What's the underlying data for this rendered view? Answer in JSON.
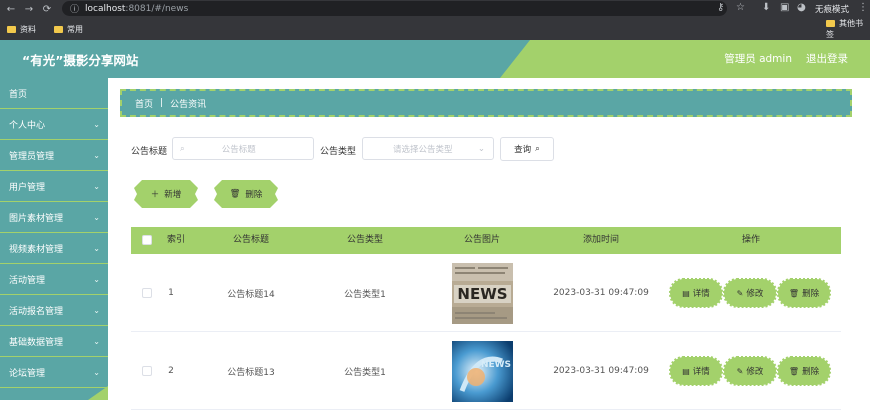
{
  "browser": {
    "url_host": "localhost",
    "url_rest": ":8081/#/news",
    "incognito_label": "无痕模式",
    "bookmarks": [
      {
        "label": "资料"
      },
      {
        "label": "常用"
      }
    ],
    "other_bookmarks": "其他书签"
  },
  "header": {
    "site_title": "“有光”摄影分享网站",
    "admin_label": "管理员 admin",
    "logout_label": "退出登录"
  },
  "sidebar": {
    "items": [
      {
        "label": "首页",
        "has_chevron": false
      },
      {
        "label": "个人中心",
        "has_chevron": true
      },
      {
        "label": "管理员管理",
        "has_chevron": true
      },
      {
        "label": "用户管理",
        "has_chevron": true
      },
      {
        "label": "图片素材管理",
        "has_chevron": true
      },
      {
        "label": "视频素材管理",
        "has_chevron": true
      },
      {
        "label": "活动管理",
        "has_chevron": true
      },
      {
        "label": "活动报名管理",
        "has_chevron": true
      },
      {
        "label": "基础数据管理",
        "has_chevron": true
      },
      {
        "label": "论坛管理",
        "has_chevron": true
      }
    ]
  },
  "breadcrumb": {
    "home": "首页",
    "current": "公告资讯"
  },
  "search": {
    "title_label": "公告标题",
    "title_placeholder": "公告标题",
    "type_label": "公告类型",
    "type_placeholder": "请选择公告类型",
    "query_button": "查询"
  },
  "actions": {
    "add_label": "新增",
    "delete_label": "删除"
  },
  "table": {
    "columns": [
      "索引",
      "公告标题",
      "公告类型",
      "公告图片",
      "添加时间",
      "操作"
    ],
    "rows": [
      {
        "index": "1",
        "title": "公告标题14",
        "type": "公告类型1",
        "image": "news-newspaper",
        "time": "2023-03-31 09:47:09"
      },
      {
        "index": "2",
        "title": "公告标题13",
        "type": "公告类型1",
        "image": "news-blue-abstract",
        "time": "2023-03-31 09:47:09"
      }
    ],
    "ops": {
      "detail": "详情",
      "edit": "修改",
      "delete": "删除"
    }
  },
  "colors": {
    "teal": "#5aa6a5",
    "green": "#a3d16b"
  }
}
